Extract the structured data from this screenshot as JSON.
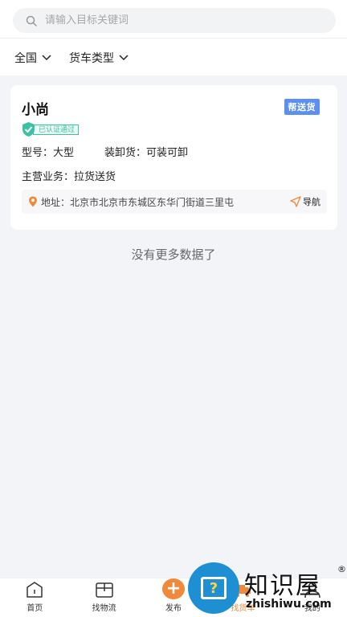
{
  "search": {
    "placeholder": "请输入目标关键词"
  },
  "filters": [
    {
      "label": "全国"
    },
    {
      "label": "货车类型"
    }
  ],
  "card": {
    "name": "小尚",
    "tag": "帮送货",
    "verified": "已认证通过",
    "model_label": "型号：",
    "model_value": "大型",
    "loading_label": "装卸货：",
    "loading_value": "可装可卸",
    "business_label": "主营业务：",
    "business_value": "拉货送货",
    "address": "地址：北京市北京市东城区东华门街道三里屯",
    "nav_label": "导航"
  },
  "empty_text": "没有更多数据了",
  "tabs": [
    {
      "label": "首页"
    },
    {
      "label": "找物流"
    },
    {
      "label": "发布"
    },
    {
      "label": "找货车"
    },
    {
      "label": "我的"
    }
  ],
  "colors": {
    "accent": "#f08a3a",
    "tag": "#5b8ff0",
    "verified": "#3cc2a3"
  },
  "watermark": {
    "title": "知识屋",
    "url": "zhishiwu.com",
    "reg": "®"
  }
}
